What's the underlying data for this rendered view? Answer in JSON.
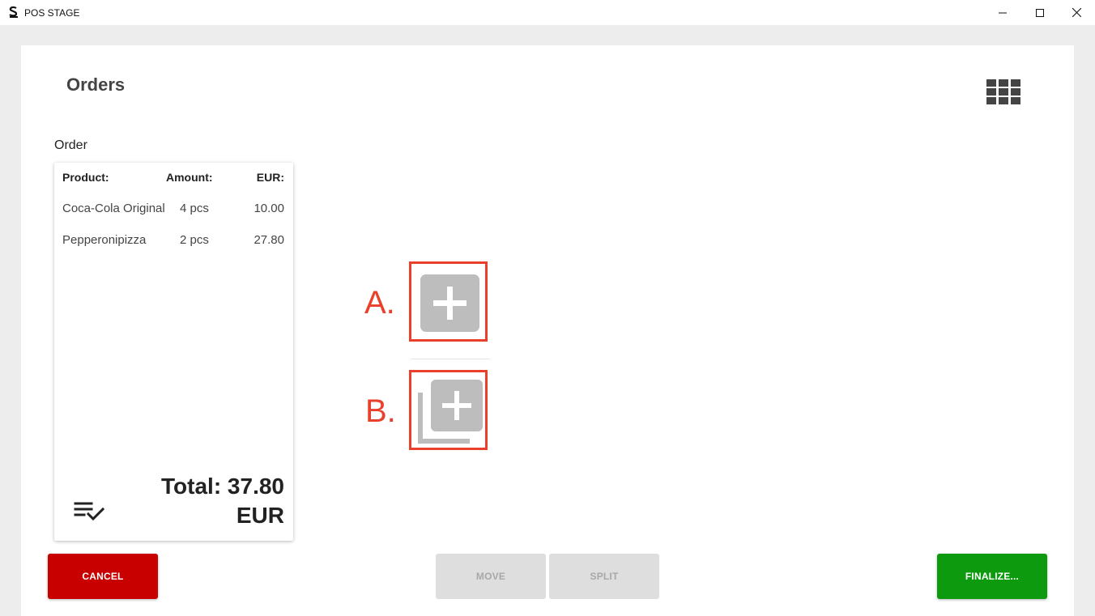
{
  "window": {
    "title": "POS STAGE",
    "icons": {
      "app": "app-logo-icon",
      "minimize": "minimize-icon",
      "maximize": "maximize-icon",
      "close": "close-icon"
    }
  },
  "page": {
    "title": "Orders",
    "view_icon": "grid-view-icon"
  },
  "order": {
    "label": "Order",
    "columns": {
      "product": "Product:",
      "amount": "Amount:",
      "eur": "EUR:"
    },
    "rows": [
      {
        "product": "Coca-Cola Original",
        "amount": "4 pcs",
        "eur": "10.00"
      },
      {
        "product": "Pepperonipizza",
        "amount": "2 pcs",
        "eur": "27.80"
      }
    ],
    "total_line1": "Total: 37.80",
    "total_line2": "EUR",
    "checklist_icon": "checklist-icon"
  },
  "annotations": {
    "marker_a": "A.",
    "marker_b": "B.",
    "highlight_color": "#e8402a"
  },
  "actions": {
    "add_icon": "add-square-icon",
    "add_multiple_icon": "add-multiple-icon"
  },
  "footer": {
    "cancel": "CANCEL",
    "move": "MOVE",
    "split": "SPLIT",
    "finalize": "FINALIZE..."
  },
  "colors": {
    "cancel": "#c80000",
    "finalize": "#0e9a0e",
    "disabled": "#dedede",
    "icon_grey": "#bdbdbd"
  }
}
